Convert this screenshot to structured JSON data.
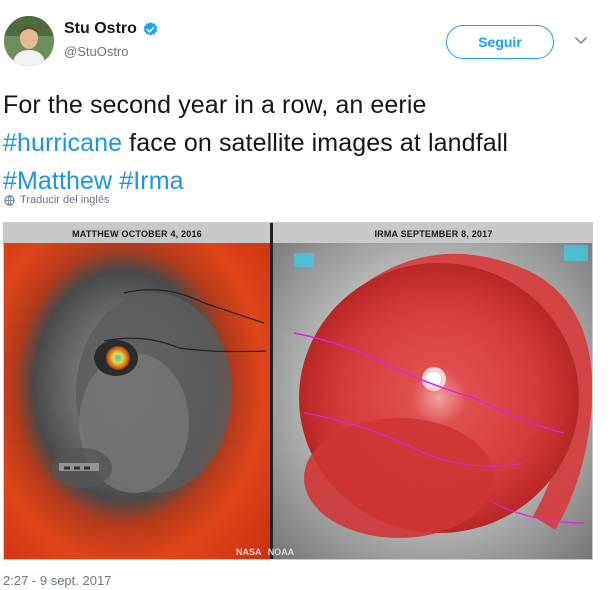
{
  "user": {
    "name": "Stu Ostro",
    "handle": "@StuOstro",
    "verified": true
  },
  "follow_button": {
    "label": "Seguir"
  },
  "tweet": {
    "text_line1": "For the second year in a row, an eerie",
    "hashtag_hurricane": "#hurricane",
    "text_mid": " face on satellite images at landfall",
    "hashtag_matthew": "#Matthew",
    "hashtag_irma": "#Irma"
  },
  "translate_label": "Traducir del inglés",
  "media": {
    "left_title": "MATTHEW OCTOBER 4, 2016",
    "right_title": "IRMA SEPTEMBER 8, 2017",
    "credit_left": "NASA",
    "credit_right": "NOAA"
  },
  "timestamp": "2:27 - 9 sept. 2017",
  "icons": {
    "verified": "verified-badge-icon",
    "chevron": "chevron-down-icon",
    "globe": "globe-icon"
  },
  "colors": {
    "accent": "#1da1f2",
    "hashtag": "#1b95e0",
    "secondary_text": "#657786"
  }
}
